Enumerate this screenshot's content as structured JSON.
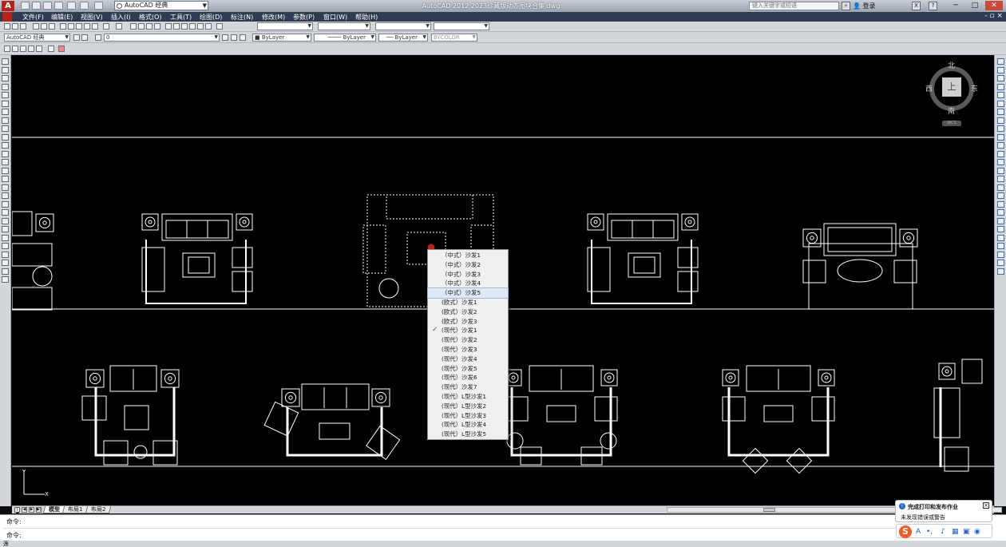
{
  "titlebar": {
    "app_logo": "A",
    "workspace": "AutoCAD 经典",
    "window_title": "AutoCAD 2012    2023珍藏版动态图块合集.dwg",
    "search_placeholder": "键入关键字或短语",
    "login": "登录"
  },
  "menubar": {
    "items": [
      "文件(F)",
      "编辑(E)",
      "视图(V)",
      "插入(I)",
      "格式(O)",
      "工具(T)",
      "绘图(D)",
      "标注(N)",
      "修改(M)",
      "参数(P)",
      "窗口(W)",
      "帮助(H)"
    ],
    "mdi_controls": "- ▫ ×"
  },
  "toolbar2": {
    "workspace_combo": "AutoCAD 经典",
    "layer_combo": "0"
  },
  "properties": {
    "color": "ByLayer",
    "linetype": "ByLayer",
    "lineweight": "ByLayer",
    "plotstyle": "BYCOLOR"
  },
  "viewcube": {
    "north": "北",
    "south": "南",
    "east": "东",
    "west": "西",
    "face": "上",
    "wcs": "WCS"
  },
  "ucs": {
    "x": "X",
    "y": "Y"
  },
  "context_menu": {
    "items": [
      {
        "label": "（中式）沙发1",
        "checked": false,
        "highlighted": false
      },
      {
        "label": "（中式）沙发2",
        "checked": false,
        "highlighted": false
      },
      {
        "label": "（中式）沙发3",
        "checked": false,
        "highlighted": false
      },
      {
        "label": "（中式）沙发4",
        "checked": false,
        "highlighted": false
      },
      {
        "label": "（中式）沙发5",
        "checked": false,
        "highlighted": true
      },
      {
        "label": "(欧式）沙发1",
        "checked": false,
        "highlighted": false
      },
      {
        "label": "(欧式）沙发2",
        "checked": false,
        "highlighted": false
      },
      {
        "label": "(欧式）沙发3",
        "checked": false,
        "highlighted": false
      },
      {
        "label": "(现代）沙发1",
        "checked": true,
        "highlighted": false
      },
      {
        "label": "(现代）沙发2",
        "checked": false,
        "highlighted": false
      },
      {
        "label": "(现代）沙发3",
        "checked": false,
        "highlighted": false
      },
      {
        "label": "(现代）沙发4",
        "checked": false,
        "highlighted": false
      },
      {
        "label": "(现代）沙发5",
        "checked": false,
        "highlighted": false
      },
      {
        "label": "(现代）沙发6",
        "checked": false,
        "highlighted": false
      },
      {
        "label": "(现代）沙发7",
        "checked": false,
        "highlighted": false
      },
      {
        "label": "(现代）L型沙发1",
        "checked": false,
        "highlighted": false
      },
      {
        "label": "(现代）L型沙发2",
        "checked": false,
        "highlighted": false
      },
      {
        "label": "(现代）L型沙发3",
        "checked": false,
        "highlighted": false
      },
      {
        "label": "(现代）L型沙发4",
        "checked": false,
        "highlighted": false
      },
      {
        "label": "(现代）L型沙发5",
        "checked": false,
        "highlighted": false
      }
    ]
  },
  "layout_tabs": {
    "tabs": [
      {
        "label": "模型",
        "active": true
      },
      {
        "label": "布局1",
        "active": false
      },
      {
        "label": "布局2",
        "active": false
      }
    ]
  },
  "command": {
    "history": "命令:",
    "prompt": "命令:",
    "input_value": ""
  },
  "statusbar": {
    "text": "莲"
  },
  "notification": {
    "title": "完成打印和发布作业",
    "message": "未发现错误或警告"
  },
  "ime": {
    "logo": "S",
    "icons": [
      "A",
      "•,",
      "♪",
      "▦",
      "▣",
      "◉"
    ]
  },
  "colors": {
    "drawing_bg": "#000000",
    "line": "#ffffff",
    "menubar": "#2e3b50",
    "accent_red": "#b3241c",
    "check": "#2a4bc0"
  }
}
